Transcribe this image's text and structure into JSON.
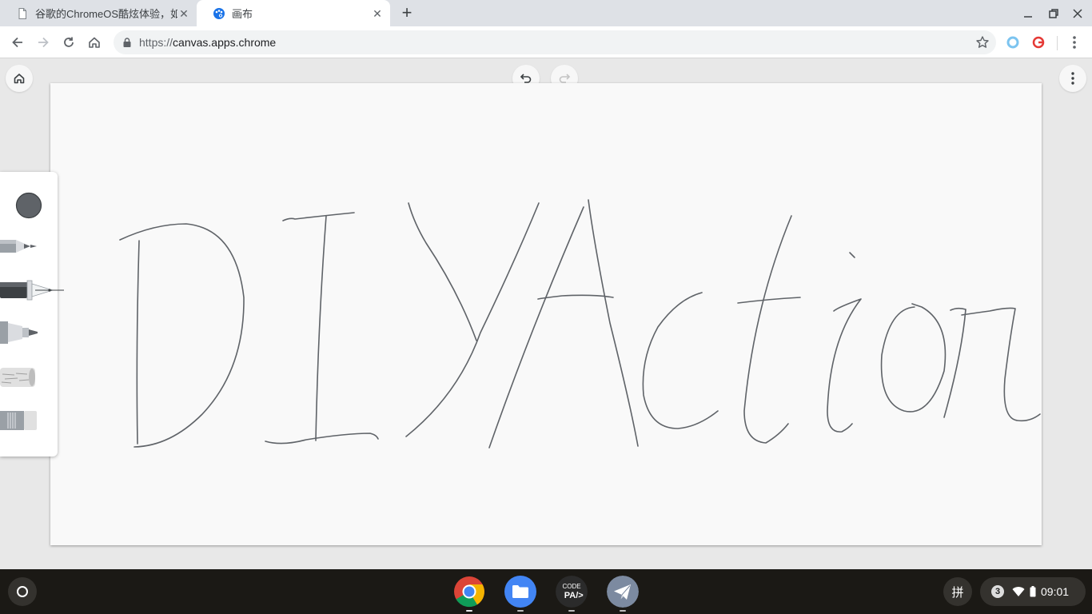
{
  "tabs": [
    {
      "title": "谷歌的ChromeOS酷炫体验，如",
      "active": false
    },
    {
      "title": "画布",
      "active": true
    }
  ],
  "address_bar": {
    "scheme": "https://",
    "host": "canvas.apps.chrome"
  },
  "canvas_app": {
    "handwriting_text": "DIYAction",
    "ink_color": "#5f6368",
    "tools": [
      "color-swatch",
      "pencil",
      "fountain-pen",
      "marker",
      "chalk",
      "eraser"
    ],
    "selected_tool": "fountain-pen"
  },
  "shelf": {
    "apps": [
      "Chrome",
      "Files",
      "Code PA",
      "Telegram"
    ],
    "ime_label": "拼",
    "notification_count": "3",
    "clock": "09:01"
  },
  "colors": {
    "tab_strip": "#dee1e6",
    "shelf": "#1b1915",
    "canvas": "#f9f9f9",
    "app_background": "#e8e8e8"
  }
}
